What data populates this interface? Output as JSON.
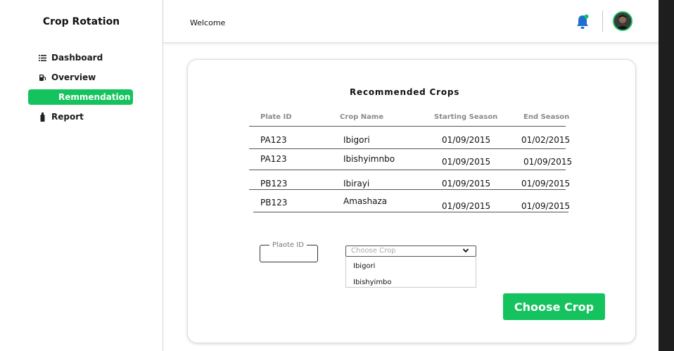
{
  "sidebar": {
    "brand": "Crop Rotation",
    "items": [
      {
        "label": "Dashboard",
        "icon": "list-icon"
      },
      {
        "label": "Overview",
        "icon": "gas-station-icon"
      },
      {
        "label": "Remmendation",
        "icon": "none"
      },
      {
        "label": "Report",
        "icon": "bottle-icon"
      }
    ],
    "active_color": "#14c35e"
  },
  "header": {
    "welcome": "Welcome",
    "bell_color": "#1f6fd1",
    "notification_dot_color": "#14c35e"
  },
  "main": {
    "title": "Recommended Crops",
    "columns": [
      "Plate ID",
      "Crop Name",
      "Starting Season",
      "End Season"
    ],
    "rows": [
      [
        "PA123",
        "Ibigori",
        "01/09/2015",
        "01/02/2015"
      ],
      [
        "PA123",
        "Ibishyimnbo",
        "01/09/2015",
        "01/09/2015"
      ],
      [
        "PB123",
        "Ibirayi",
        "01/09/2015",
        "01/09/2015"
      ],
      [
        "PB123",
        "Amashaza",
        "01/09/2015",
        "01/09/2015"
      ]
    ],
    "form": {
      "plate_label": "Plaote ID",
      "crop_placeholder": "Choose Crop",
      "crop_options": [
        "Ibigori",
        "Ibishyimbo"
      ],
      "submit_label": "Choose Crop"
    }
  }
}
